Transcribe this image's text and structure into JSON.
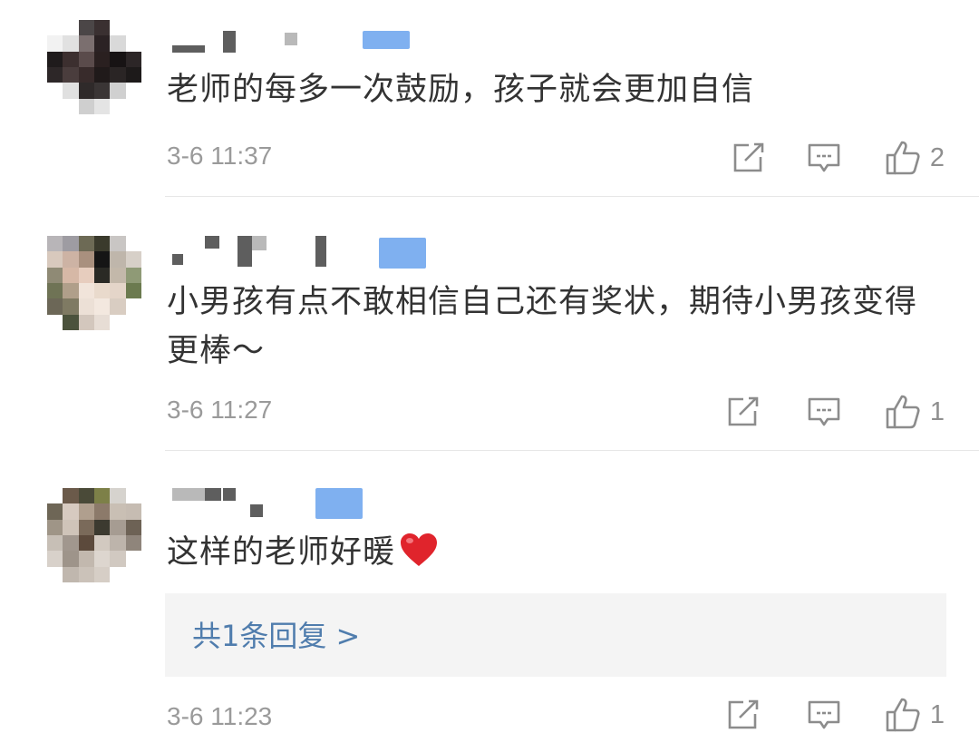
{
  "comments": [
    {
      "text": "老师的每多一次鼓励，孩子就会更加自信",
      "time": "3-6 11:37",
      "likes": "2"
    },
    {
      "text": "小男孩有点不敢相信自己还有奖状，期待小男孩变得更棒～",
      "time": "3-6 11:27",
      "likes": "1"
    },
    {
      "text": "这样的老师好暖",
      "emoji": "heart-emoji",
      "time": "3-6 11:23",
      "likes": "1",
      "reply_link": "共1条回复 >"
    }
  ],
  "icons": {
    "share": "share-icon",
    "comment": "comment-icon",
    "like": "thumbs-up-icon"
  },
  "colors": {
    "text": "#333333",
    "meta": "#9a9a9a",
    "link": "#507dad",
    "divider": "#e6e6e6",
    "reply_bg": "#f4f4f4",
    "badge": "#7fb0f0",
    "heart": "#e0242c"
  }
}
